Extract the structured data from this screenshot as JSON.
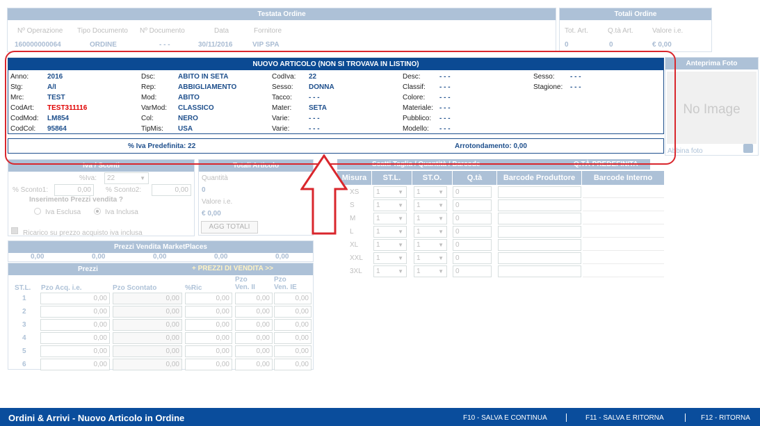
{
  "testata": {
    "title": "Testata Ordine",
    "headers": [
      "Nº Operazione",
      "Tipo Documento",
      "Nº Documento",
      "Data",
      "Fornitore"
    ],
    "values": [
      "160000000064",
      "ORDINE",
      "- - -",
      "30/11/2016",
      "VIP SPA"
    ]
  },
  "totali_ordine": {
    "title": "Totali Ordine",
    "headers": [
      "Tot. Art.",
      "Q.tà Art.",
      "Valore i.e."
    ],
    "values": [
      "0",
      "0",
      "€ 0,00"
    ]
  },
  "nuovo_articolo": {
    "title": "NUOVO ARTICOLO (NON SI TROVAVA IN LISTINO)",
    "col1": [
      {
        "label": "Anno:",
        "value": "2016"
      },
      {
        "label": "Stg:",
        "value": "A/I"
      },
      {
        "label": "Mrc:",
        "value": "TEST"
      },
      {
        "label": "CodArt:",
        "value": "TEST311116"
      },
      {
        "label": "CodMod:",
        "value": "LM854"
      },
      {
        "label": "CodCol:",
        "value": "95864"
      }
    ],
    "col2": [
      {
        "label": "Dsc:",
        "value": "ABITO IN SETA"
      },
      {
        "label": "Rep:",
        "value": "ABBIGLIAMENTO"
      },
      {
        "label": "Mod:",
        "value": "ABITO"
      },
      {
        "label": "VarMod:",
        "value": "CLASSICO"
      },
      {
        "label": "Col:",
        "value": "NERO"
      },
      {
        "label": "TipMis:",
        "value": "USA"
      }
    ],
    "col3": [
      {
        "label": "CodIva:",
        "value": "22"
      },
      {
        "label": "Sesso:",
        "value": "DONNA"
      },
      {
        "label": "Tacco:",
        "value": "- - -"
      },
      {
        "label": "Mater:",
        "value": "SETA"
      },
      {
        "label": "Varie:",
        "value": "- - -"
      },
      {
        "label": "Varie:",
        "value": "- - -"
      }
    ],
    "col4": [
      {
        "label": "Desc:",
        "value": "- - -"
      },
      {
        "label": "Classif:",
        "value": "- - -"
      },
      {
        "label": "Colore:",
        "value": "- - -"
      },
      {
        "label": "Materiale:",
        "value": "- - -"
      },
      {
        "label": "Pubblico:",
        "value": "- - -"
      },
      {
        "label": "Modello:",
        "value": "- - -"
      }
    ],
    "col5": [
      {
        "label": "Sesso:",
        "value": "- - -"
      },
      {
        "label": "Stagione:",
        "value": "- - -"
      }
    ],
    "iva_predefinita": "% Iva Predefinita: 22",
    "arrotondamento": "Arrotondamento: 0,00",
    "codart_color": "#e00000"
  },
  "anteprima": {
    "title": "Anteprima Foto",
    "no_image": "No Image",
    "abbina": "Abbina foto"
  },
  "iva_sconti": {
    "title": "Iva / Sconti",
    "iva_label": "%Iva:",
    "iva_value": "22",
    "sconto1_label": "% Sconto1:",
    "sconto1_value": "0,00",
    "sconto2_label": "% Sconto2:",
    "sconto2_value": "0,00",
    "inserimento": "Inserimento Prezzi vendita ?",
    "iva_esclusa": "Iva Esclusa",
    "iva_inclusa": "Iva Inclusa",
    "ricarico": "Ricarico su prezzo acquisto iva inclusa"
  },
  "totali_articolo": {
    "title": "Totali Articolo",
    "quantita_label": "Quantità",
    "quantita_value": "0",
    "valore_label": "Valore i.e.",
    "valore_value": "€ 0,00",
    "agg_button": "AGG TOTALI"
  },
  "marketplaces": {
    "title": "Prezzi Vendita MarketPlaces",
    "values": [
      "0,00",
      "0,00",
      "0,00",
      "0,00",
      "0,00"
    ]
  },
  "prezzi": {
    "title": "Prezzi",
    "link": "+ PREZZI DI VENDITA >>",
    "headers": [
      "ST.L.",
      "Pzo Acq. i.e.",
      "Pzo Scontato",
      "%Ric",
      "Pzo Ven. II",
      "Pzo Ven. IE"
    ],
    "rows": [
      {
        "n": "1",
        "v": [
          "0,00",
          "0,00",
          "0,00",
          "0,00",
          "0,00"
        ]
      },
      {
        "n": "2",
        "v": [
          "0,00",
          "0,00",
          "0,00",
          "0,00",
          "0,00"
        ]
      },
      {
        "n": "3",
        "v": [
          "0,00",
          "0,00",
          "0,00",
          "0,00",
          "0,00"
        ]
      },
      {
        "n": "4",
        "v": [
          "0,00",
          "0,00",
          "0,00",
          "0,00",
          "0,00"
        ]
      },
      {
        "n": "5",
        "v": [
          "0,00",
          "0,00",
          "0,00",
          "0,00",
          "0,00"
        ]
      },
      {
        "n": "6",
        "v": [
          "0,00",
          "0,00",
          "0,00",
          "0,00",
          "0,00"
        ]
      }
    ]
  },
  "taglie": {
    "title": "Scatti Taglia / Quantità / Barcode",
    "extra": "Q.TÀ PREDEFINITA",
    "headers": [
      "Misura",
      "ST.L.",
      "ST.O.",
      "Q.tà",
      "Barcode Produttore",
      "Barcode Interno"
    ],
    "rows": [
      {
        "misura": "XS",
        "stl": "1",
        "sto": "1",
        "qta": "0"
      },
      {
        "misura": "S",
        "stl": "1",
        "sto": "1",
        "qta": "0"
      },
      {
        "misura": "M",
        "stl": "1",
        "sto": "1",
        "qta": "0"
      },
      {
        "misura": "L",
        "stl": "1",
        "sto": "1",
        "qta": "0"
      },
      {
        "misura": "XL",
        "stl": "1",
        "sto": "1",
        "qta": "0"
      },
      {
        "misura": "XXL",
        "stl": "1",
        "sto": "1",
        "qta": "0"
      },
      {
        "misura": "3XL",
        "stl": "1",
        "sto": "1",
        "qta": "0"
      }
    ]
  },
  "footer": {
    "title": "Ordini & Arrivi - Nuovo Articolo in Ordine",
    "f10": "F10 - SALVA E CONTINUA",
    "f11": "F11 - SALVA E RITORNA",
    "f12": "F12 - RITORNA",
    "bg": "#0a4d9c"
  },
  "colors": {
    "accent": "#2a5f98",
    "highlight_border": "#d9262c",
    "arrow": "#d9262c"
  }
}
